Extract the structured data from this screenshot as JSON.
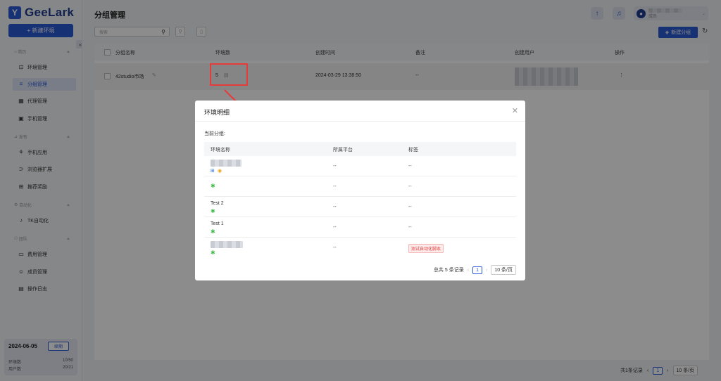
{
  "app": {
    "logo": "GeeLark",
    "new_env_button": "+ 新建环境"
  },
  "sidebar": {
    "groups": [
      {
        "label": "简历",
        "items": [
          {
            "label": "环境管理",
            "icon": "env-icon"
          },
          {
            "label": "分组管理",
            "icon": "list-icon",
            "active": true
          },
          {
            "label": "代理管理",
            "icon": "proxy-icon"
          },
          {
            "label": "手机管理",
            "icon": "phone-icon"
          }
        ]
      },
      {
        "label": "发布",
        "items": [
          {
            "label": "手机应用",
            "icon": "app-icon"
          },
          {
            "label": "浏览器扩展",
            "icon": "extension-icon"
          },
          {
            "label": "推荐奖励",
            "icon": "gift-icon"
          }
        ]
      },
      {
        "label": "自动化",
        "items": [
          {
            "label": "TK自动化",
            "icon": "tiktok-icon"
          }
        ]
      },
      {
        "label": "团队",
        "items": [
          {
            "label": "费用管理",
            "icon": "billing-icon"
          },
          {
            "label": "成员管理",
            "icon": "members-icon"
          },
          {
            "label": "操作日志",
            "icon": "log-icon"
          }
        ]
      }
    ],
    "plan": {
      "date": "2024-06-05",
      "renew": "续期",
      "env_label": "环境数",
      "env_value": "10/50",
      "user_label": "用户数",
      "user_value": "20/21"
    }
  },
  "header": {
    "title": "分组管理",
    "user_role": "成员"
  },
  "toolbar": {
    "search_placeholder": "搜索",
    "new_group_button": "新建分组"
  },
  "table": {
    "columns": [
      "分组名称",
      "环境数",
      "创建时间",
      "备注",
      "创建用户",
      "操作"
    ],
    "rows": [
      {
        "name": "42studio市场",
        "env_count": "5",
        "created": "2024-03-29 13:38:50",
        "note": "--",
        "actions": "⋮"
      }
    ]
  },
  "footer": {
    "total": "共1条记录",
    "page": "1",
    "per_page": "10 条/页"
  },
  "modal": {
    "title": "环境明细",
    "subtitle": "当前分组:",
    "columns": [
      "环境名称",
      "所属平台",
      "标签"
    ],
    "rows": [
      {
        "name": "",
        "platform": "--",
        "tag": "--"
      },
      {
        "name": "",
        "platform": "--",
        "tag": "--"
      },
      {
        "name": "Test 2",
        "platform": "--",
        "tag": "--"
      },
      {
        "name": "Test 1",
        "platform": "--",
        "tag": "--"
      },
      {
        "name": "",
        "platform": "--",
        "tag": "测试自动化脚本"
      }
    ],
    "pager": {
      "total": "总共 5 条记录",
      "page": "1",
      "per_page": "10 条/页"
    }
  },
  "colors": {
    "primary": "#2a59d6",
    "highlight": "#e53b3b"
  }
}
